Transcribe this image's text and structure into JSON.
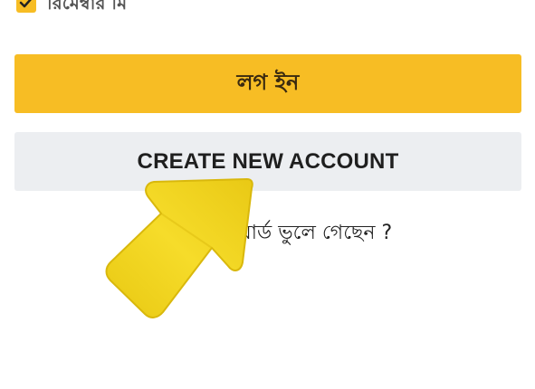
{
  "remember": {
    "label": "রিমেম্বার মি",
    "checked": true
  },
  "login_button": {
    "label": "লগ ইন"
  },
  "create_account_button": {
    "label": "CREATE NEW ACCOUNT"
  },
  "forgot_password": {
    "label": "ডসওয়ার্ড ভুলে গেছেন ?"
  },
  "colors": {
    "accent": "#f7bd24",
    "secondary_button": "#eceef1",
    "pointer_arrow": "#f2d41e"
  },
  "icons": {
    "checkbox": "checkmark-icon",
    "overlay": "pointer-arrow-icon"
  }
}
